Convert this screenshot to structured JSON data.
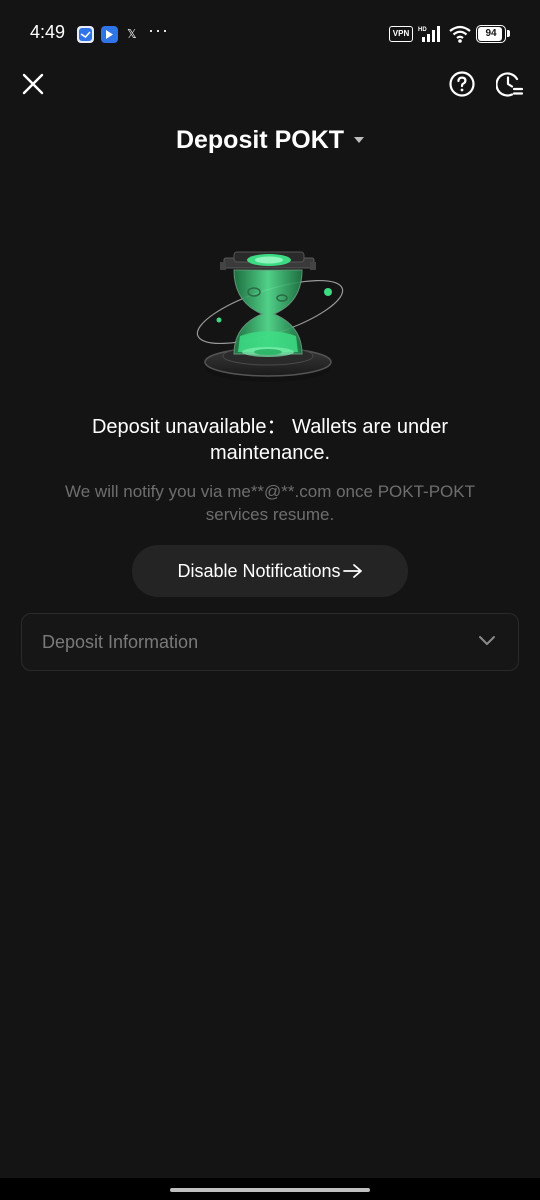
{
  "status_bar": {
    "time": "4:49",
    "x_glyph": "𝕏",
    "more_dots": "···",
    "vpn_label": "VPN",
    "network_label": "HD",
    "battery_level": "94"
  },
  "header": {
    "title": "Deposit POKT",
    "close_icon": "close-icon",
    "help_icon": "help-circle-icon",
    "history_icon": "history-clock-icon"
  },
  "message": {
    "headline": "Deposit unavailable：  Wallets are under maintenance.",
    "subtext": "We will notify you via me**@**.com once POKT-POKT services resume."
  },
  "notification_button": {
    "label": "Disable Notifications"
  },
  "deposit_information": {
    "label": "Deposit Information"
  },
  "colors": {
    "background": "#141414",
    "accent_green": "#3ddc84",
    "button_bg": "#242424",
    "muted_text": "#6e6e6e"
  }
}
